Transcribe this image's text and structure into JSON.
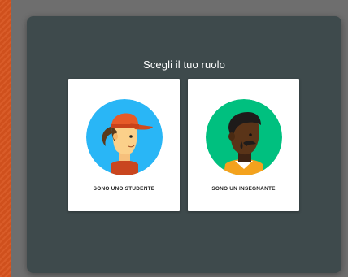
{
  "dialog": {
    "title": "Scegli il tuo ruolo"
  },
  "roles": [
    {
      "label": "SONO UNO STUDENTE",
      "icon": "student-avatar-icon",
      "color": "#29b6f6"
    },
    {
      "label": "SONO UN INSEGNANTE",
      "icon": "teacher-avatar-icon",
      "color": "#00c07f"
    }
  ],
  "colors": {
    "page_background": "#d7531e",
    "backdrop": "#6e6e6e",
    "dialog": "#3e4a4c",
    "card": "#ffffff"
  }
}
